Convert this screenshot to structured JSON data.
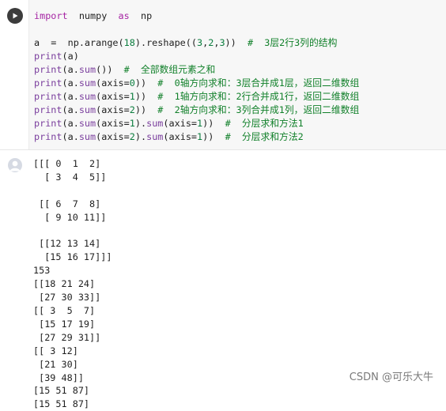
{
  "code_cell": {
    "lines": [
      {
        "segs": [
          {
            "t": "import",
            "c": "kw"
          },
          {
            "t": "  numpy  "
          },
          {
            "t": "as",
            "c": "kw"
          },
          {
            "t": "  np"
          }
        ]
      },
      {
        "segs": []
      },
      {
        "segs": [
          {
            "t": "a  =  np.arange("
          },
          {
            "t": "18",
            "c": "num"
          },
          {
            "t": ").reshape(("
          },
          {
            "t": "3",
            "c": "num"
          },
          {
            "t": ","
          },
          {
            "t": "2",
            "c": "num"
          },
          {
            "t": ","
          },
          {
            "t": "3",
            "c": "num"
          },
          {
            "t": "))  "
          },
          {
            "t": "#  3层2行3列的结构",
            "c": "cm"
          }
        ]
      },
      {
        "segs": [
          {
            "t": "print",
            "c": "fn"
          },
          {
            "t": "(a)"
          }
        ]
      },
      {
        "segs": [
          {
            "t": "print",
            "c": "fn"
          },
          {
            "t": "(a."
          },
          {
            "t": "sum",
            "c": "fn"
          },
          {
            "t": "())  "
          },
          {
            "t": "#  全部数组元素之和",
            "c": "cm"
          }
        ]
      },
      {
        "segs": [
          {
            "t": "print",
            "c": "fn"
          },
          {
            "t": "(a."
          },
          {
            "t": "sum",
            "c": "fn"
          },
          {
            "t": "(axis="
          },
          {
            "t": "0",
            "c": "num"
          },
          {
            "t": "))  "
          },
          {
            "t": "#  0轴方向求和：3层合并成1层，返回二维数组",
            "c": "cm"
          }
        ]
      },
      {
        "segs": [
          {
            "t": "print",
            "c": "fn"
          },
          {
            "t": "(a."
          },
          {
            "t": "sum",
            "c": "fn"
          },
          {
            "t": "(axis="
          },
          {
            "t": "1",
            "c": "num"
          },
          {
            "t": "))  "
          },
          {
            "t": "#  1轴方向求和：2行合并成1行，返回二维数组",
            "c": "cm"
          }
        ]
      },
      {
        "segs": [
          {
            "t": "print",
            "c": "fn"
          },
          {
            "t": "(a."
          },
          {
            "t": "sum",
            "c": "fn"
          },
          {
            "t": "(axis="
          },
          {
            "t": "2",
            "c": "num"
          },
          {
            "t": "))  "
          },
          {
            "t": "#  2轴方向求和：3列合并成1列，返回二维数组",
            "c": "cm"
          }
        ]
      },
      {
        "segs": [
          {
            "t": "print",
            "c": "fn"
          },
          {
            "t": "(a."
          },
          {
            "t": "sum",
            "c": "fn"
          },
          {
            "t": "(axis="
          },
          {
            "t": "1",
            "c": "num"
          },
          {
            "t": ")."
          },
          {
            "t": "sum",
            "c": "fn"
          },
          {
            "t": "(axis="
          },
          {
            "t": "1",
            "c": "num"
          },
          {
            "t": "))  "
          },
          {
            "t": "#  分层求和方法1",
            "c": "cm"
          }
        ]
      },
      {
        "segs": [
          {
            "t": "print",
            "c": "fn"
          },
          {
            "t": "(a."
          },
          {
            "t": "sum",
            "c": "fn"
          },
          {
            "t": "(axis="
          },
          {
            "t": "2",
            "c": "num"
          },
          {
            "t": ")."
          },
          {
            "t": "sum",
            "c": "fn"
          },
          {
            "t": "(axis="
          },
          {
            "t": "1",
            "c": "num"
          },
          {
            "t": "))  "
          },
          {
            "t": "#  分层求和方法2",
            "c": "cm"
          }
        ]
      }
    ]
  },
  "output": {
    "text": "[[[ 0  1  2]\n  [ 3  4  5]]\n\n [[ 6  7  8]\n  [ 9 10 11]]\n\n [[12 13 14]\n  [15 16 17]]]\n153\n[[18 21 24]\n [27 30 33]]\n[[ 3  5  7]\n [15 17 19]\n [27 29 31]]\n[[ 3 12]\n [21 30]\n [39 48]]\n[15 51 87]\n[15 51 87]"
  },
  "watermark": "CSDN @可乐大牛",
  "icons": {
    "run": "play-icon",
    "output": "user-avatar-icon"
  },
  "colors": {
    "keyword": "#a626a4",
    "builtin": "#7a3e9d",
    "number": "#0b7d3e",
    "comment": "#11802a",
    "editor_bg": "#f7f7f7"
  }
}
